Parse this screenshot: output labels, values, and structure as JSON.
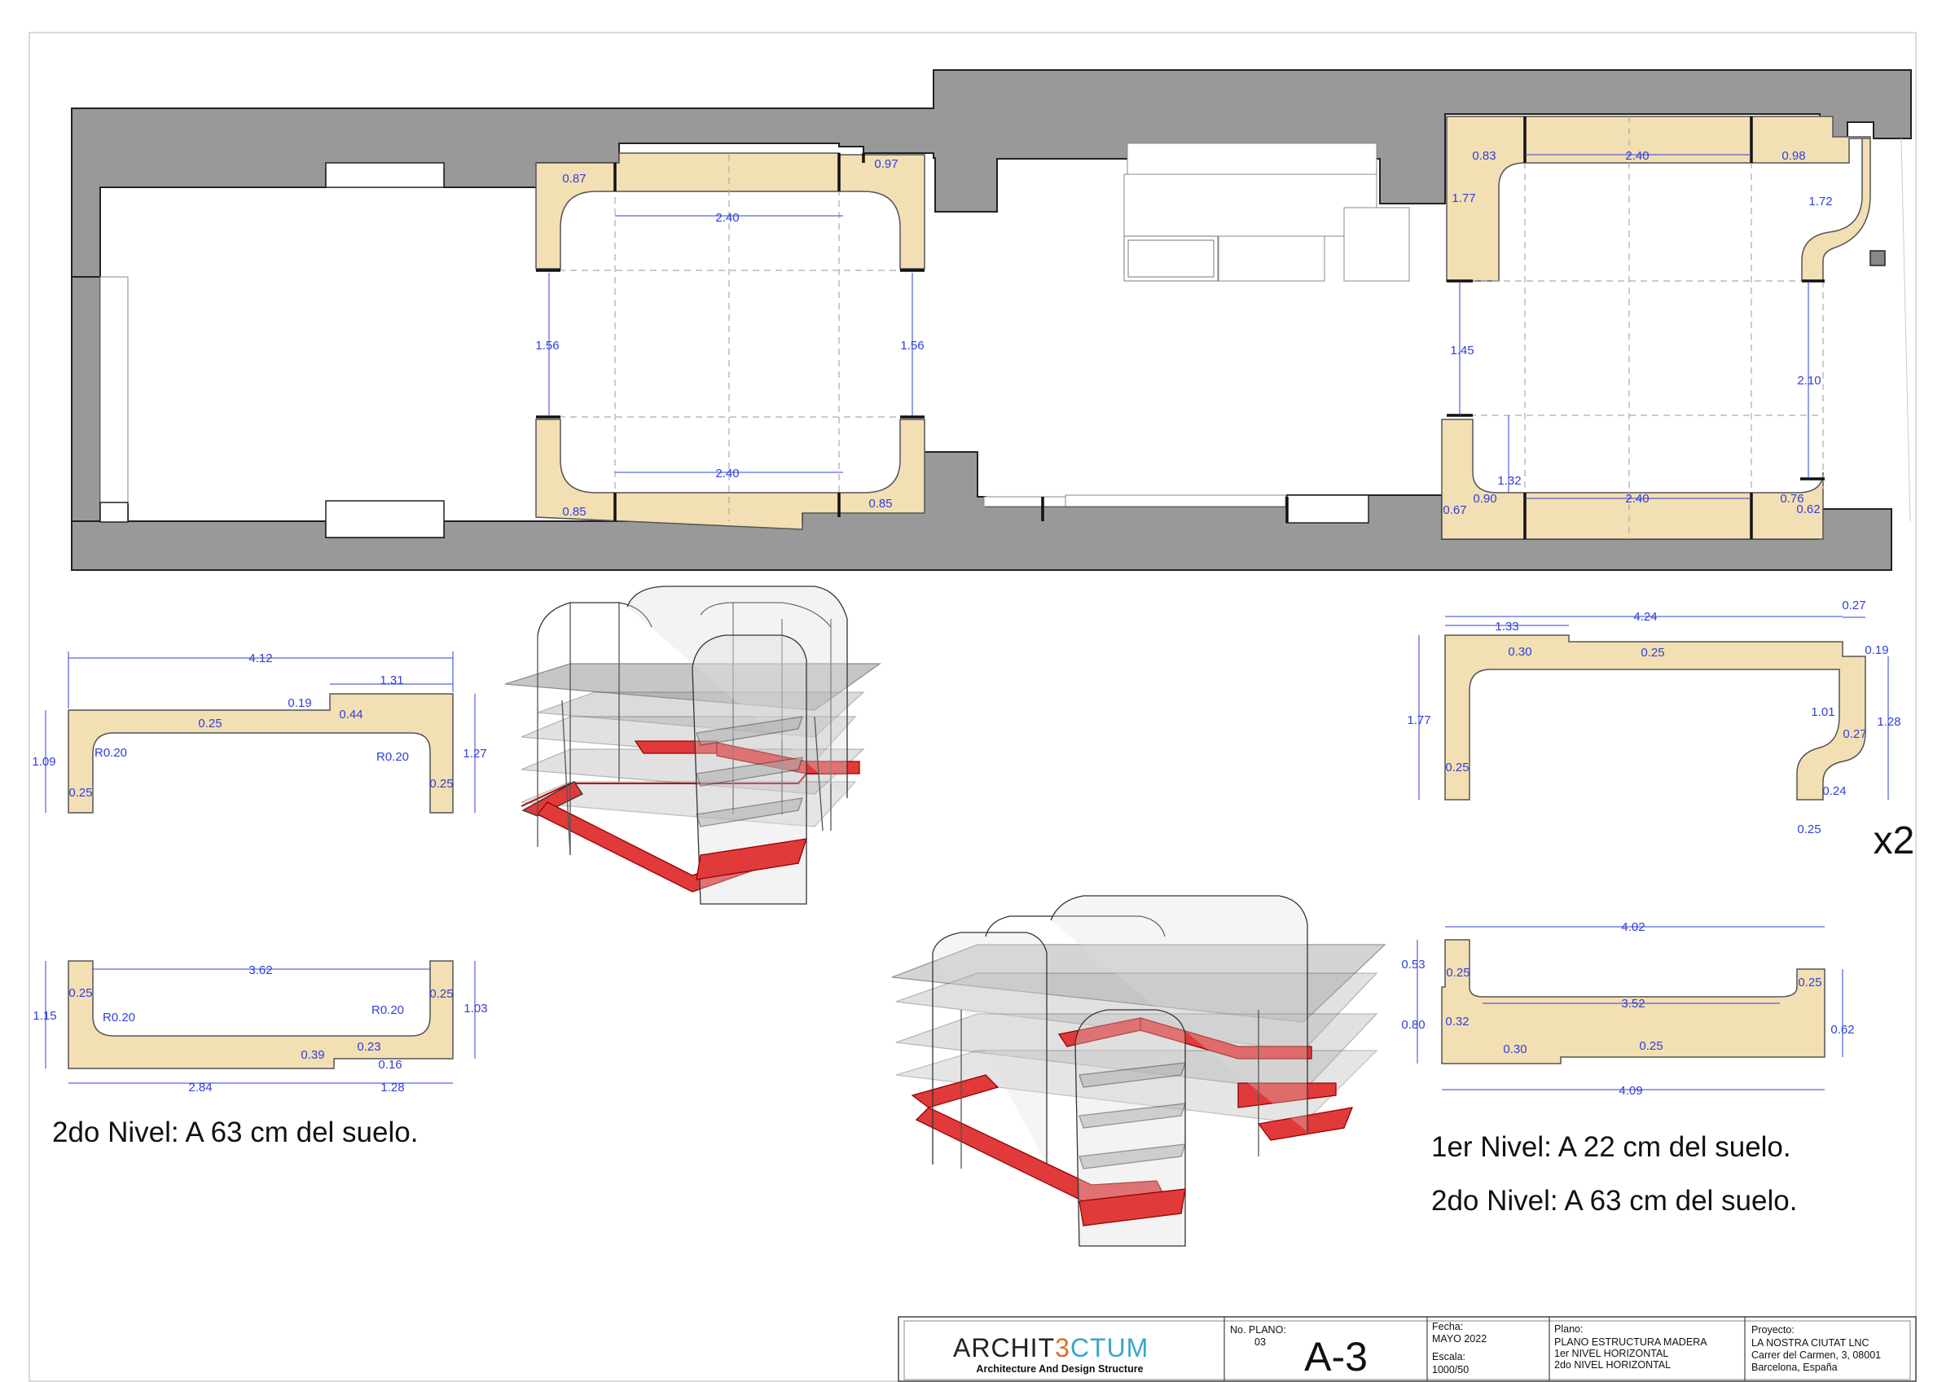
{
  "colors": {
    "wall": "#999999",
    "wood": "#f3dfb4",
    "dimension": "#2f3fd8",
    "red": "#e03a3a"
  },
  "plan": {
    "left_module": {
      "top_left": "0.87",
      "top_right": "0.97",
      "top_span": "2.40",
      "left_height": "1.56",
      "right_height": "1.56",
      "bottom_span": "2.40",
      "bottom_left": "0.85",
      "bottom_right": "0.85"
    },
    "right_module": {
      "top_left": "0.83",
      "top_span": "2.40",
      "top_right": "0.98",
      "left_upper": "1.77",
      "right_upper": "1.72",
      "left_mid": "1.45",
      "right_mid": "2.10",
      "inner_height": "1.32",
      "bottom_left_outer": "0.67",
      "bottom_left": "0.90",
      "bottom_span": "2.40",
      "bottom_right": "0.76",
      "bottom_right_outer": "0.62"
    }
  },
  "piece_a": {
    "length": "4.12",
    "step": "1.31",
    "width": "0.25",
    "notch": "0.19",
    "notch_depth": "0.44",
    "radius_left": "R0.20",
    "radius_right": "R0.20",
    "height_left": "1.09",
    "height_right": "1.27",
    "leg_left": "0.25",
    "leg_right": "0.25"
  },
  "piece_b": {
    "inner": "3.62",
    "leg_left": "0.25",
    "leg_right": "0.25",
    "radius_left": "R0.20",
    "radius_right": "R0.20",
    "height_left": "1.15",
    "height_right": "1.03",
    "d1": "0.39",
    "d2": "0.23",
    "d3": "0.16",
    "bottom_left": "2.84",
    "bottom_right": "1.28"
  },
  "piece_c": {
    "overall": "4.24",
    "step": "1.33",
    "top_right": "0.27",
    "w1": "0.30",
    "w2": "0.25",
    "notch": "0.19",
    "height": "1.77",
    "right_height": "1.28",
    "inner_right": "1.01",
    "curve": "0.27",
    "leg": "0.25",
    "foot": "0.24",
    "foot_w": "0.25",
    "multiplier": "x2"
  },
  "piece_d": {
    "top": "4.02",
    "left_height": "0.53",
    "left_leg": "0.25",
    "inner": "3.52",
    "right_leg": "0.25",
    "left_total": "0.80",
    "left_step": "0.32",
    "right_total": "0.62",
    "w1": "0.30",
    "w2": "0.25",
    "bottom": "4.09"
  },
  "captions": {
    "left": "2do Nivel: A 63 cm  del suelo.",
    "right_1": "1er Nivel: A 22 cm  del suelo.",
    "right_2": "2do Nivel: A 63 cm  del suelo."
  },
  "title_block": {
    "logo_part1": "ARCHIT",
    "logo_part2": "3",
    "logo_part3": "CTUM",
    "tagline": "Architecture And Design Structure",
    "plano_no_label": "No. PLANO:",
    "plano_no": "03",
    "sheet": "A-3",
    "fecha_label": "Fecha:",
    "fecha": "MAYO 2022",
    "escala_label": "Escala:",
    "escala": "1000/50",
    "plano_label": "Plano:",
    "plano_lines": [
      "PLANO ESTRUCTURA MADERA",
      "1er NIVEL HORIZONTAL",
      "2do NIVEL HORIZONTAL"
    ],
    "proyecto_label": "Proyecto:",
    "proyecto_lines": [
      "LA NOSTRA CIUTAT LNC",
      "Carrer del Carmen, 3, 08001",
      "Barcelona, España"
    ]
  }
}
